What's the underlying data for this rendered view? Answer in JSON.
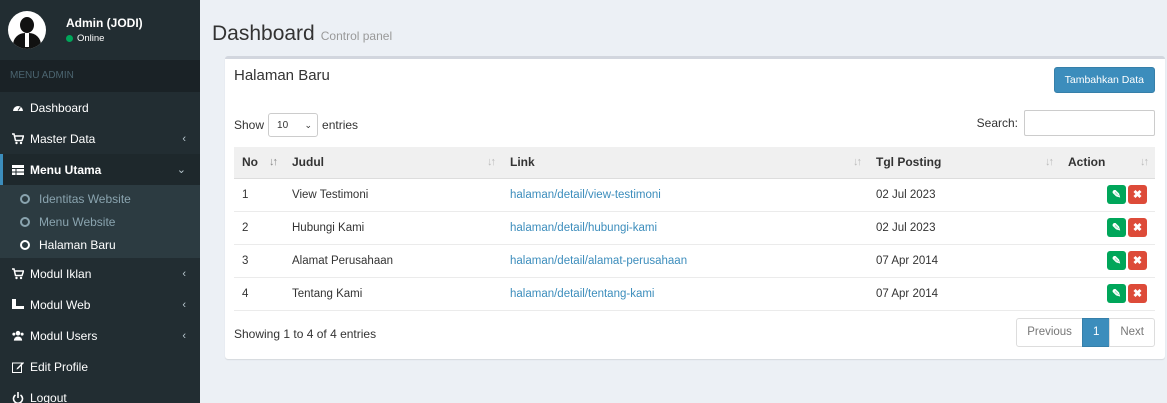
{
  "user": {
    "name": "Admin (JODI)",
    "status": "Online"
  },
  "sidebar": {
    "header": "MENU ADMIN",
    "items": [
      {
        "label": "Dashboard",
        "icon": "dashboard-icon"
      },
      {
        "label": "Master Data",
        "icon": "cart-icon"
      },
      {
        "label": "Menu Utama",
        "icon": "table-icon"
      },
      {
        "label": "Modul Iklan",
        "icon": "cart-icon"
      },
      {
        "label": "Modul Web",
        "icon": "sitemap-icon"
      },
      {
        "label": "Modul Users",
        "icon": "users-icon"
      },
      {
        "label": "Edit Profile",
        "icon": "edit-icon"
      },
      {
        "label": "Logout",
        "icon": "power-icon"
      }
    ],
    "submenu": [
      {
        "label": "Identitas Website"
      },
      {
        "label": "Menu Website"
      },
      {
        "label": "Halaman Baru"
      }
    ]
  },
  "header": {
    "title": "Dashboard",
    "subtitle": "Control panel"
  },
  "box": {
    "title": "Halaman Baru",
    "add_button": "Tambahkan Data",
    "show_label": "Show",
    "entries_value": "10",
    "entries_label": "entries",
    "search_label": "Search:",
    "columns": [
      "No",
      "Judul",
      "Link",
      "Tgl Posting",
      "Action"
    ],
    "rows": [
      {
        "no": "1",
        "judul": "View Testimoni",
        "link": "halaman/detail/view-testimoni",
        "tgl": "02 Jul 2023"
      },
      {
        "no": "2",
        "judul": "Hubungi Kami",
        "link": "halaman/detail/hubungi-kami",
        "tgl": "02 Jul 2023"
      },
      {
        "no": "3",
        "judul": "Alamat Perusahaan",
        "link": "halaman/detail/alamat-perusahaan",
        "tgl": "07 Apr 2014"
      },
      {
        "no": "4",
        "judul": "Tentang Kami",
        "link": "halaman/detail/tentang-kami",
        "tgl": "07 Apr 2014"
      }
    ],
    "info": "Showing 1 to 4 of 4 entries",
    "pager": {
      "previous": "Previous",
      "page": "1",
      "next": "Next"
    }
  },
  "colors": {
    "sidebar": "#222d32",
    "primary": "#3c8dbc",
    "success": "#00a65a",
    "danger": "#dd4b39"
  }
}
